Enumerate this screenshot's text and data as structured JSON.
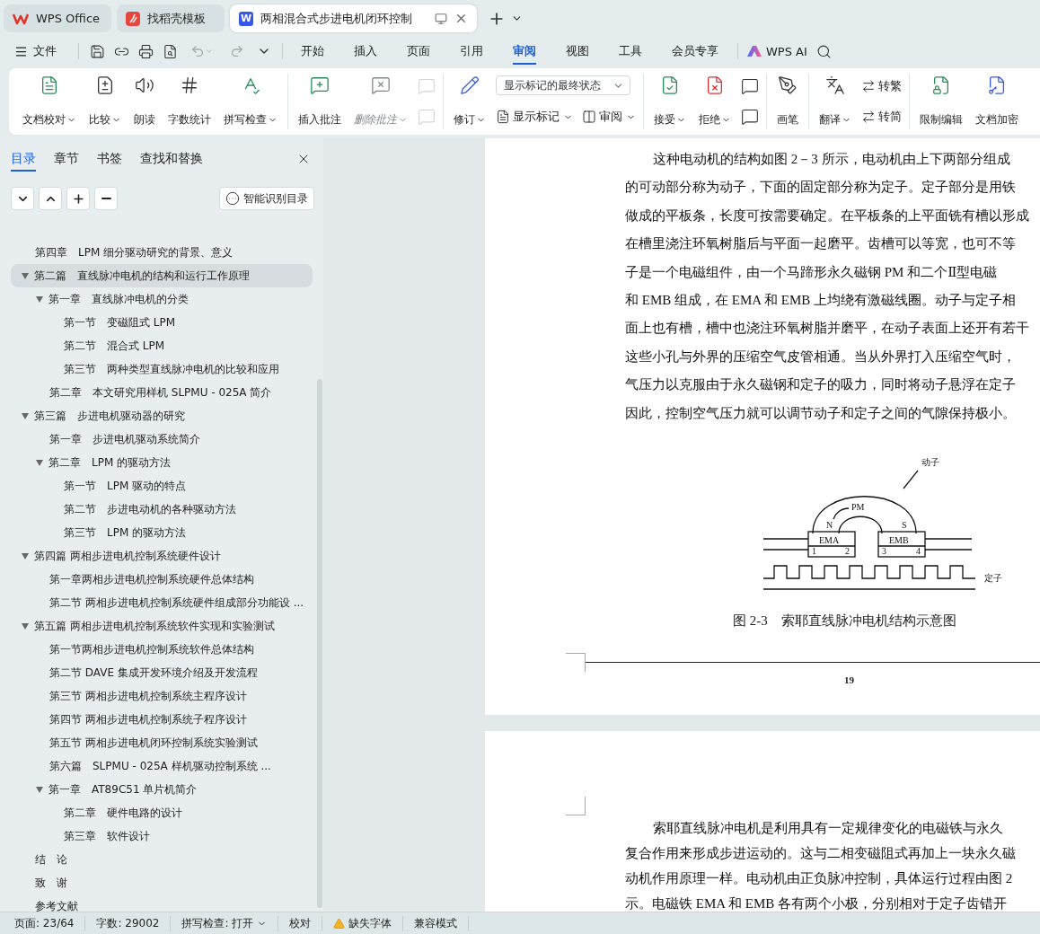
{
  "tabs": [
    {
      "label": "WPS Office",
      "selected": false,
      "kind": "home"
    },
    {
      "label": "找稻壳模板",
      "selected": false,
      "kind": "template"
    },
    {
      "label": "两相混合式步进电机闭环控制",
      "selected": true,
      "kind": "document",
      "logo_letter": "W"
    }
  ],
  "menu": {
    "file": "文件",
    "tabs": [
      {
        "label": "开始",
        "selected": false
      },
      {
        "label": "插入",
        "selected": false
      },
      {
        "label": "页面",
        "selected": false
      },
      {
        "label": "引用",
        "selected": false
      },
      {
        "label": "审阅",
        "selected": true
      },
      {
        "label": "视图",
        "selected": false
      },
      {
        "label": "工具",
        "selected": false
      },
      {
        "label": "会员专享",
        "selected": false
      }
    ],
    "ai": "WPS AI"
  },
  "ribbon": {
    "groups": [
      {
        "items": [
          {
            "kind": "large",
            "label": "文档校对",
            "menu": true,
            "disabled": false
          },
          {
            "kind": "large",
            "label": "比较",
            "menu": true,
            "disabled": false
          },
          {
            "kind": "large",
            "label": "朗读",
            "menu": false,
            "disabled": false
          },
          {
            "kind": "large",
            "label": "字数统计",
            "menu": false,
            "disabled": false
          },
          {
            "kind": "large",
            "label": "拼写检查",
            "menu": true,
            "disabled": false
          }
        ]
      },
      {
        "items": [
          {
            "kind": "large",
            "label": "插入批注",
            "menu": false,
            "disabled": false
          },
          {
            "kind": "large",
            "label": "删除批注",
            "menu": true,
            "disabled": true
          },
          {
            "kind": "column",
            "children": [
              {
                "kind": "icon",
                "disabled": true
              },
              {
                "kind": "icon",
                "disabled": true
              }
            ]
          }
        ]
      },
      {
        "items": [
          {
            "kind": "large",
            "label": "修订",
            "menu": true,
            "disabled": false
          },
          {
            "kind": "column",
            "children": [
              {
                "kind": "select",
                "value": "显示标记的最终状态"
              },
              {
                "kind": "row",
                "children": [
                  {
                    "kind": "small",
                    "label": "显示标记",
                    "menu": true,
                    "disabled": false
                  },
                  {
                    "kind": "small",
                    "label": "审阅",
                    "menu": true,
                    "disabled": false
                  }
                ]
              }
            ]
          }
        ]
      },
      {
        "items": [
          {
            "kind": "large",
            "label": "接受",
            "menu": true,
            "disabled": false
          },
          {
            "kind": "large",
            "label": "拒绝",
            "menu": true,
            "disabled": false
          },
          {
            "kind": "column",
            "children": [
              {
                "kind": "icon",
                "disabled": false
              },
              {
                "kind": "icon",
                "disabled": false
              }
            ]
          }
        ]
      },
      {
        "items": [
          {
            "kind": "large",
            "label": "画笔",
            "menu": false,
            "disabled": false
          }
        ]
      },
      {
        "items": [
          {
            "kind": "large",
            "label": "翻译",
            "menu": true,
            "disabled": false
          },
          {
            "kind": "column",
            "children": [
              {
                "kind": "small",
                "label": "转繁",
                "menu": false,
                "disabled": false
              },
              {
                "kind": "small",
                "label": "转简",
                "menu": false,
                "disabled": false
              }
            ]
          }
        ]
      },
      {
        "items": [
          {
            "kind": "large",
            "label": "限制编辑",
            "menu": false,
            "disabled": false
          },
          {
            "kind": "large",
            "label": "文档加密",
            "menu": false,
            "disabled": false
          }
        ]
      }
    ]
  },
  "sidebar": {
    "tabs": [
      {
        "label": "目录",
        "selected": true
      },
      {
        "label": "章节",
        "selected": false
      },
      {
        "label": "书签",
        "selected": false
      },
      {
        "label": "查找和替换",
        "selected": false
      }
    ],
    "smart_button": "智能识别目录",
    "outline": [
      {
        "label": "第四章　LPM 细分驱动研究的背景、意义",
        "selected": false
      },
      {
        "label": "第二篇　直线脉冲电机的结构和运行工作原理",
        "selected": true,
        "expanded": true,
        "children": [
          {
            "label": "第一章　直线脉冲电机的分类",
            "selected": false,
            "expanded": true,
            "children": [
              {
                "label": "第一节　变磁阻式 LPM",
                "selected": false
              },
              {
                "label": "第二节　混合式 LPM",
                "selected": false
              },
              {
                "label": "第三节　两种类型直线脉冲电机的比较和应用",
                "selected": false
              }
            ]
          },
          {
            "label": "第二章　本文研究用样机 SLPMU - 025A 简介",
            "selected": false
          }
        ]
      },
      {
        "label": "第三篇　步进电机驱动器的研究",
        "selected": false,
        "expanded": true,
        "children": [
          {
            "label": "第一章　步进电机驱动系统简介",
            "selected": false
          },
          {
            "label": "第二章　LPM 的驱动方法",
            "selected": false,
            "expanded": true,
            "children": [
              {
                "label": "第一节　LPM 驱动的特点",
                "selected": false
              },
              {
                "label": "第二节　步进电动机的各种驱动方法",
                "selected": false
              },
              {
                "label": "第三节　LPM 的驱动方法",
                "selected": false
              }
            ]
          }
        ]
      },
      {
        "label": "第四篇  两相步进电机控制系统硬件设计",
        "selected": false,
        "expanded": true,
        "children": [
          {
            "label": "第一章两相步进电机控制系统硬件总体结构",
            "selected": false
          },
          {
            "label": "第二节  两相步进电机控制系统硬件组成部分功能设 ...",
            "selected": false
          }
        ]
      },
      {
        "label": "第五篇  两相步进电机控制系统软件实现和实验测试",
        "selected": false,
        "expanded": true,
        "children": [
          {
            "label": "第一节两相步进电机控制系统软件总体结构",
            "selected": false
          },
          {
            "label": "第二节 DAVE  集成开发环境介绍及开发流程",
            "selected": false
          },
          {
            "label": "第三节  两相步进电机控制系统主程序设计",
            "selected": false
          },
          {
            "label": "第四节  两相步进电机控制系统子程序设计",
            "selected": false
          },
          {
            "label": "第五节  两相步进电机闭环控制系统实验测试",
            "selected": false
          },
          {
            "label": "第六篇　SLPMU - 025A 样机驱动控制系统 ...",
            "selected": false
          },
          {
            "label": "第一章　AT89C51 单片机简介",
            "selected": false,
            "expanded": true,
            "children": [
              {
                "label": "第二章　硬件电路的设计",
                "selected": false
              },
              {
                "label": "第三章　软件设计",
                "selected": false
              }
            ]
          }
        ]
      },
      {
        "label": "结　论",
        "selected": false
      },
      {
        "label": "致　谢",
        "selected": false
      },
      {
        "label": "参考文献",
        "selected": false
      }
    ]
  },
  "document": {
    "pages": [
      {
        "paragraphs": [
          {
            "lines": [
              "这种电动机的结构如图 2－3 所示，电动机由上下两部分组成",
              "的可动部分称为动子，下面的固定部分称为定子。定子部分是用铁",
              "做成的平板条，长度可按需要确定。在平板条的上平面铣有槽以形成",
              "在槽里浇注环氧树脂后与平面一起磨平。齿槽可以等宽，也可不等",
              "子是一个电磁组件，由一个马蹄形永久磁钢 PM 和二个Ⅱ型电磁",
              "和 EMB 组成，在 EMA 和 EMB 上均绕有激磁线圈。动子与定子相",
              "面上也有槽，槽中也浇注环氧树脂并磨平，在动子表面上还开有若干",
              "这些小孔与外界的压缩空气皮管相通。当从外界打入压缩空气时，",
              "气压力以克服由于永久磁钢和定子的吸力，同时将动子悬浮在定子",
              "因此，控制空气压力就可以调节动子和定子之间的气隙保持极小。"
            ]
          }
        ],
        "figure": {
          "labels": [
            "动子",
            "PM",
            "N",
            "S",
            "EMA",
            "EMB",
            "1",
            "2",
            "3",
            "4",
            "定子"
          ],
          "caption": "图 2-3　索耶直线脉冲电机结构示意图"
        },
        "page_number": "19"
      },
      {
        "paragraphs": [
          {
            "lines": [
              "索耶直线脉冲电机是利用具有一定规律变化的电磁铁与永久",
              "复合作用来形成步进运动的。这与二相变磁阻式再加上一块永久磁",
              "动机作用原理一样。电动机由正负脉冲控制，具体运行过程由图 2",
              "示。电磁铁 EMA 和 EMB 各有两个小极，分别相对于定子齿错开"
            ]
          }
        ]
      }
    ]
  },
  "status_bar": {
    "items": [
      {
        "label": "页面: 23/64",
        "kind": "text"
      },
      {
        "label": "字数: 29002",
        "kind": "text"
      },
      {
        "label": "拼写检查: 打开",
        "kind": "menu"
      },
      {
        "label": "校对",
        "kind": "text"
      },
      {
        "label": "缺失字体",
        "kind": "warning"
      },
      {
        "label": "兼容模式",
        "kind": "text"
      }
    ]
  }
}
